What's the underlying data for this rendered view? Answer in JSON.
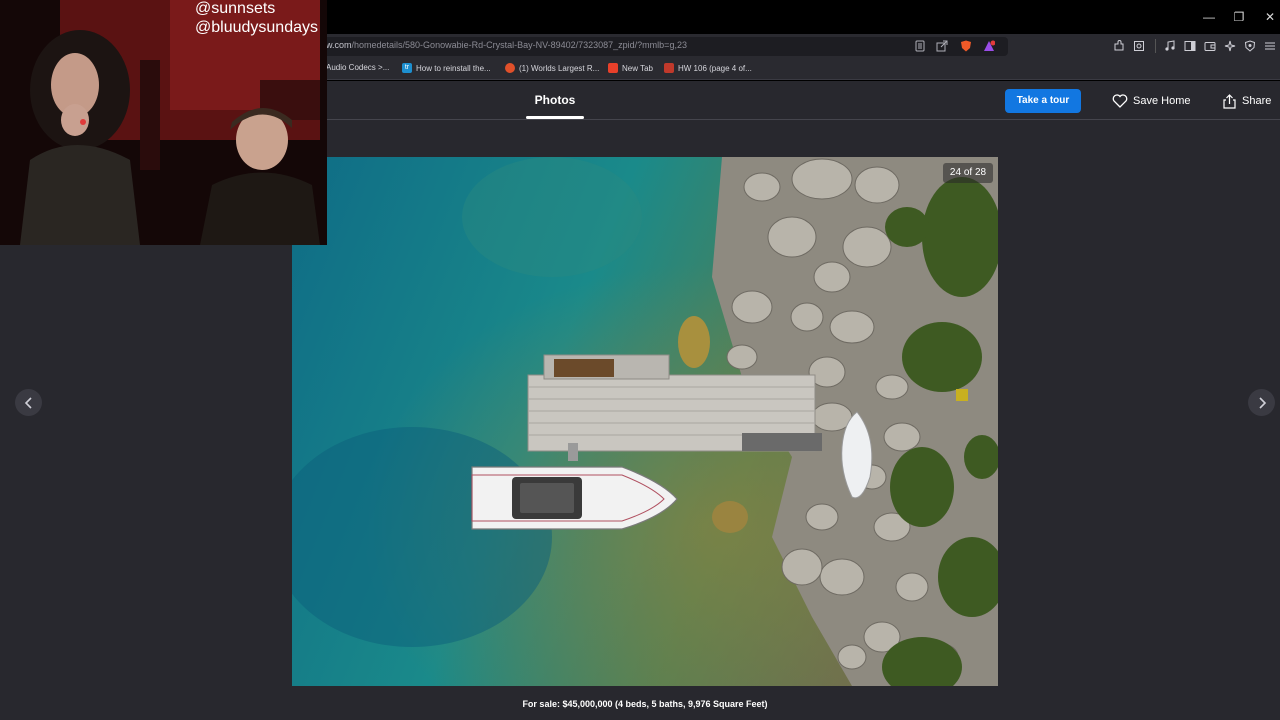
{
  "browser": {
    "url_prefix": "w.com",
    "url_path": "/homedetails/580-Gonowabie-Rd-Crystal-Bay-NV-89402/7323087_zpid/?mmlb=g,23",
    "bookmarks": [
      {
        "label": "Audio Codecs >...",
        "color": "#2a2a30"
      },
      {
        "label": "How to reinstall the...",
        "color": "#1d8fcf"
      },
      {
        "label": "(1) Worlds Largest R...",
        "color": "#e0502a"
      },
      {
        "label": "New Tab",
        "color": "#e8402a"
      },
      {
        "label": "HW 106 (page 4 of...",
        "color": "#c0392b"
      }
    ]
  },
  "page": {
    "tab_photos": "Photos",
    "tour_button": "Take a tour",
    "save_home": "Save Home",
    "share": "Share",
    "photo_counter": "24 of 28",
    "caption": "For sale: $45,000,000 (4 beds, 5 baths, 9,976 Square Feet)"
  },
  "overlay": {
    "name1": "@sunnsets",
    "name2": "@bluudysundays"
  },
  "colors": {
    "accent": "#1277e1",
    "page_bg": "#28282e"
  }
}
